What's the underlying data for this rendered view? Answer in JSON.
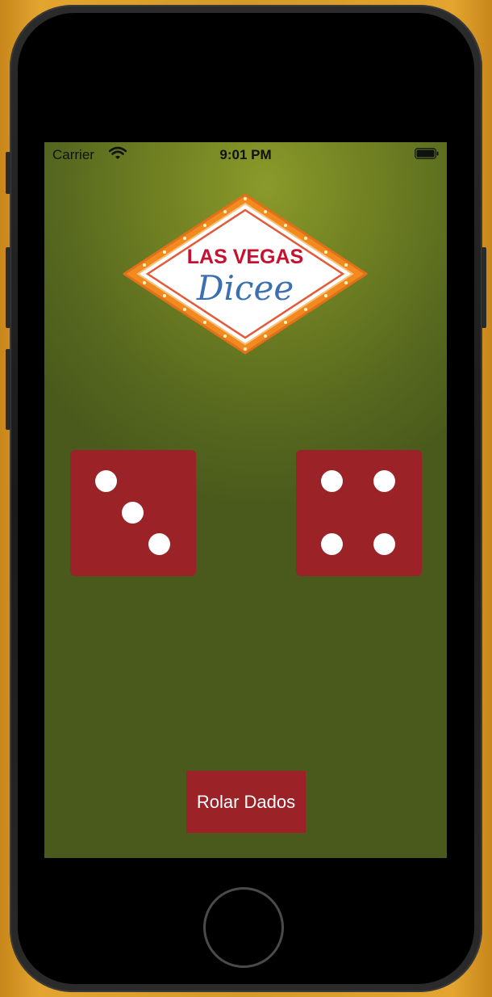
{
  "status_bar": {
    "carrier": "Carrier",
    "time": "9:01 PM",
    "wifi_icon": "wifi-icon",
    "battery_icon": "battery-icon"
  },
  "logo": {
    "line1": "LAS VEGAS",
    "line2": "Dicee"
  },
  "dice": {
    "left_value": 3,
    "right_value": 4
  },
  "roll_button": {
    "label": "Rolar Dados"
  },
  "colors": {
    "die": "#9b2226",
    "felt": "#6f7f22",
    "logo_red": "#c8102e",
    "logo_blue": "#3b6fb0",
    "marquee_orange": "#f28a1f"
  }
}
